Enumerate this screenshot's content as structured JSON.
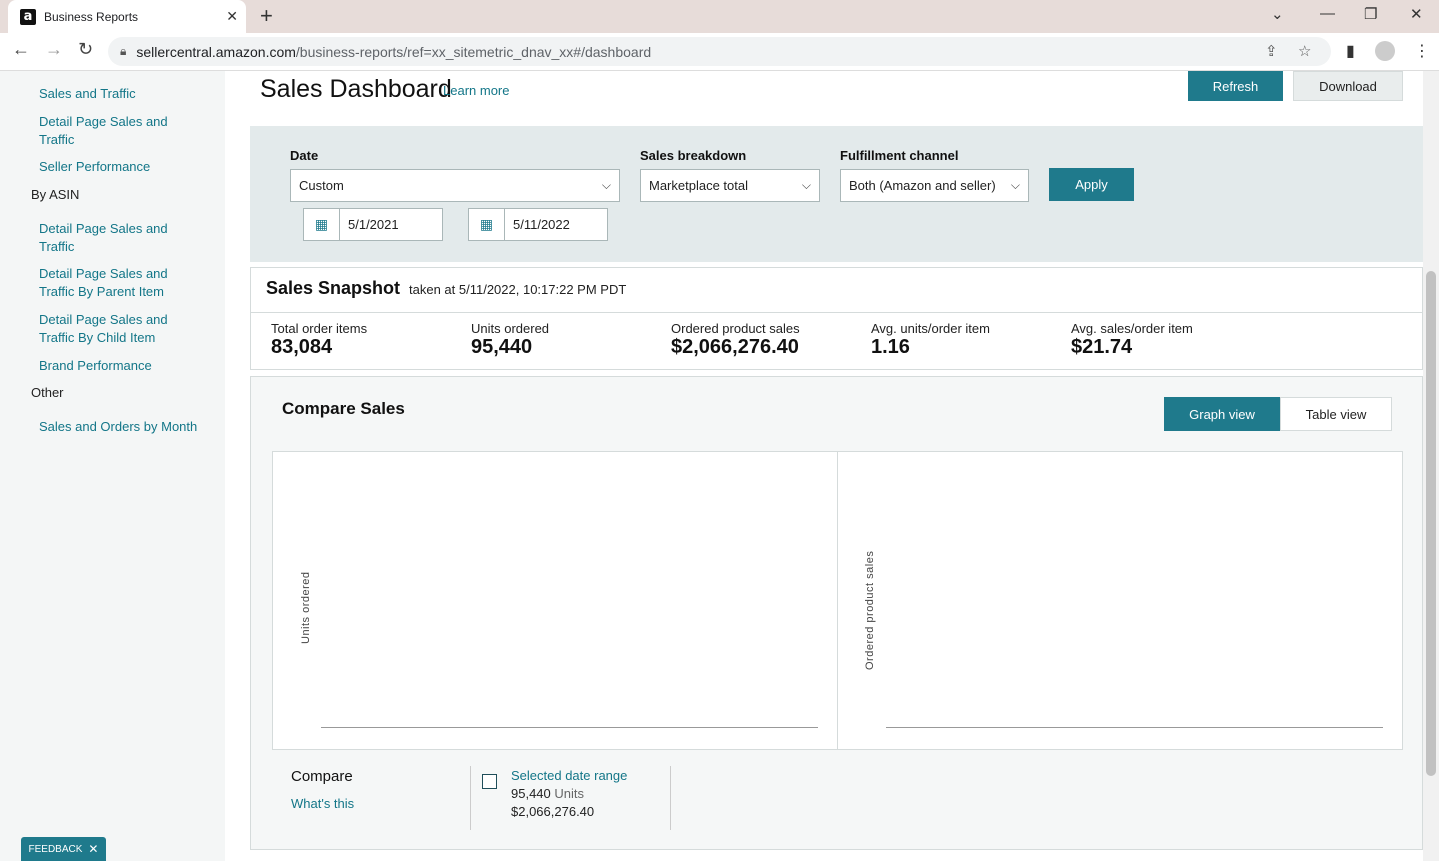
{
  "browser": {
    "tab_title": "Business Reports",
    "favicon_letter": "a",
    "url_host": "sellercentral.amazon.com",
    "url_path": "/business-reports/ref=xx_sitemetric_dnav_xx#/dashboard"
  },
  "sidebar": {
    "items": [
      {
        "label": "Sales and Traffic",
        "type": "link"
      },
      {
        "label": "Detail Page Sales and Traffic",
        "type": "link"
      },
      {
        "label": "Seller Performance",
        "type": "link"
      },
      {
        "label": "By ASIN",
        "type": "heading"
      },
      {
        "label": "Detail Page Sales and Traffic",
        "type": "link"
      },
      {
        "label": "Detail Page Sales and Traffic By Parent Item",
        "type": "link"
      },
      {
        "label": "Detail Page Sales and Traffic By Child Item",
        "type": "link"
      },
      {
        "label": "Brand Performance",
        "type": "link"
      },
      {
        "label": "Other",
        "type": "heading"
      },
      {
        "label": "Sales and Orders by Month",
        "type": "link"
      }
    ]
  },
  "header": {
    "title": "Sales Dashboard",
    "learn_more": "Learn more",
    "refresh_label": "Refresh",
    "download_label": "Download"
  },
  "filters": {
    "date_label": "Date",
    "date_value": "Custom",
    "start_date": "5/1/2021",
    "end_date": "5/11/2022",
    "breakdown_label": "Sales breakdown",
    "breakdown_value": "Marketplace total",
    "channel_label": "Fulfillment channel",
    "channel_value": "Both (Amazon and seller)",
    "apply_label": "Apply"
  },
  "snapshot": {
    "title": "Sales Snapshot",
    "taken_at": "taken at 5/11/2022, 10:17:22 PM PDT",
    "metrics": [
      {
        "label": "Total order items",
        "value": "83,084"
      },
      {
        "label": "Units ordered",
        "value": "95,440"
      },
      {
        "label": "Ordered product sales",
        "value": "$2,066,276.40"
      },
      {
        "label": "Avg. units/order item",
        "value": "1.16"
      },
      {
        "label": "Avg. sales/order item",
        "value": "$21.74"
      }
    ]
  },
  "compare": {
    "title": "Compare Sales",
    "graph_view": "Graph view",
    "table_view": "Table view",
    "left_chart_ylabel": "Units ordered",
    "right_chart_ylabel": "Ordered product sales",
    "footer_title": "Compare",
    "whats_this": "What's this",
    "range_label": "Selected date range",
    "range_units_value": "95,440",
    "range_units_suffix": "Units",
    "range_sales": "$2,066,276.40"
  },
  "feedback_label": "FEEDBACK",
  "colors": {
    "accent": "#1f7a8c",
    "link": "#137688",
    "filter_bg": "#e3eaeb",
    "sidebar_bg": "#f4f6f6"
  }
}
